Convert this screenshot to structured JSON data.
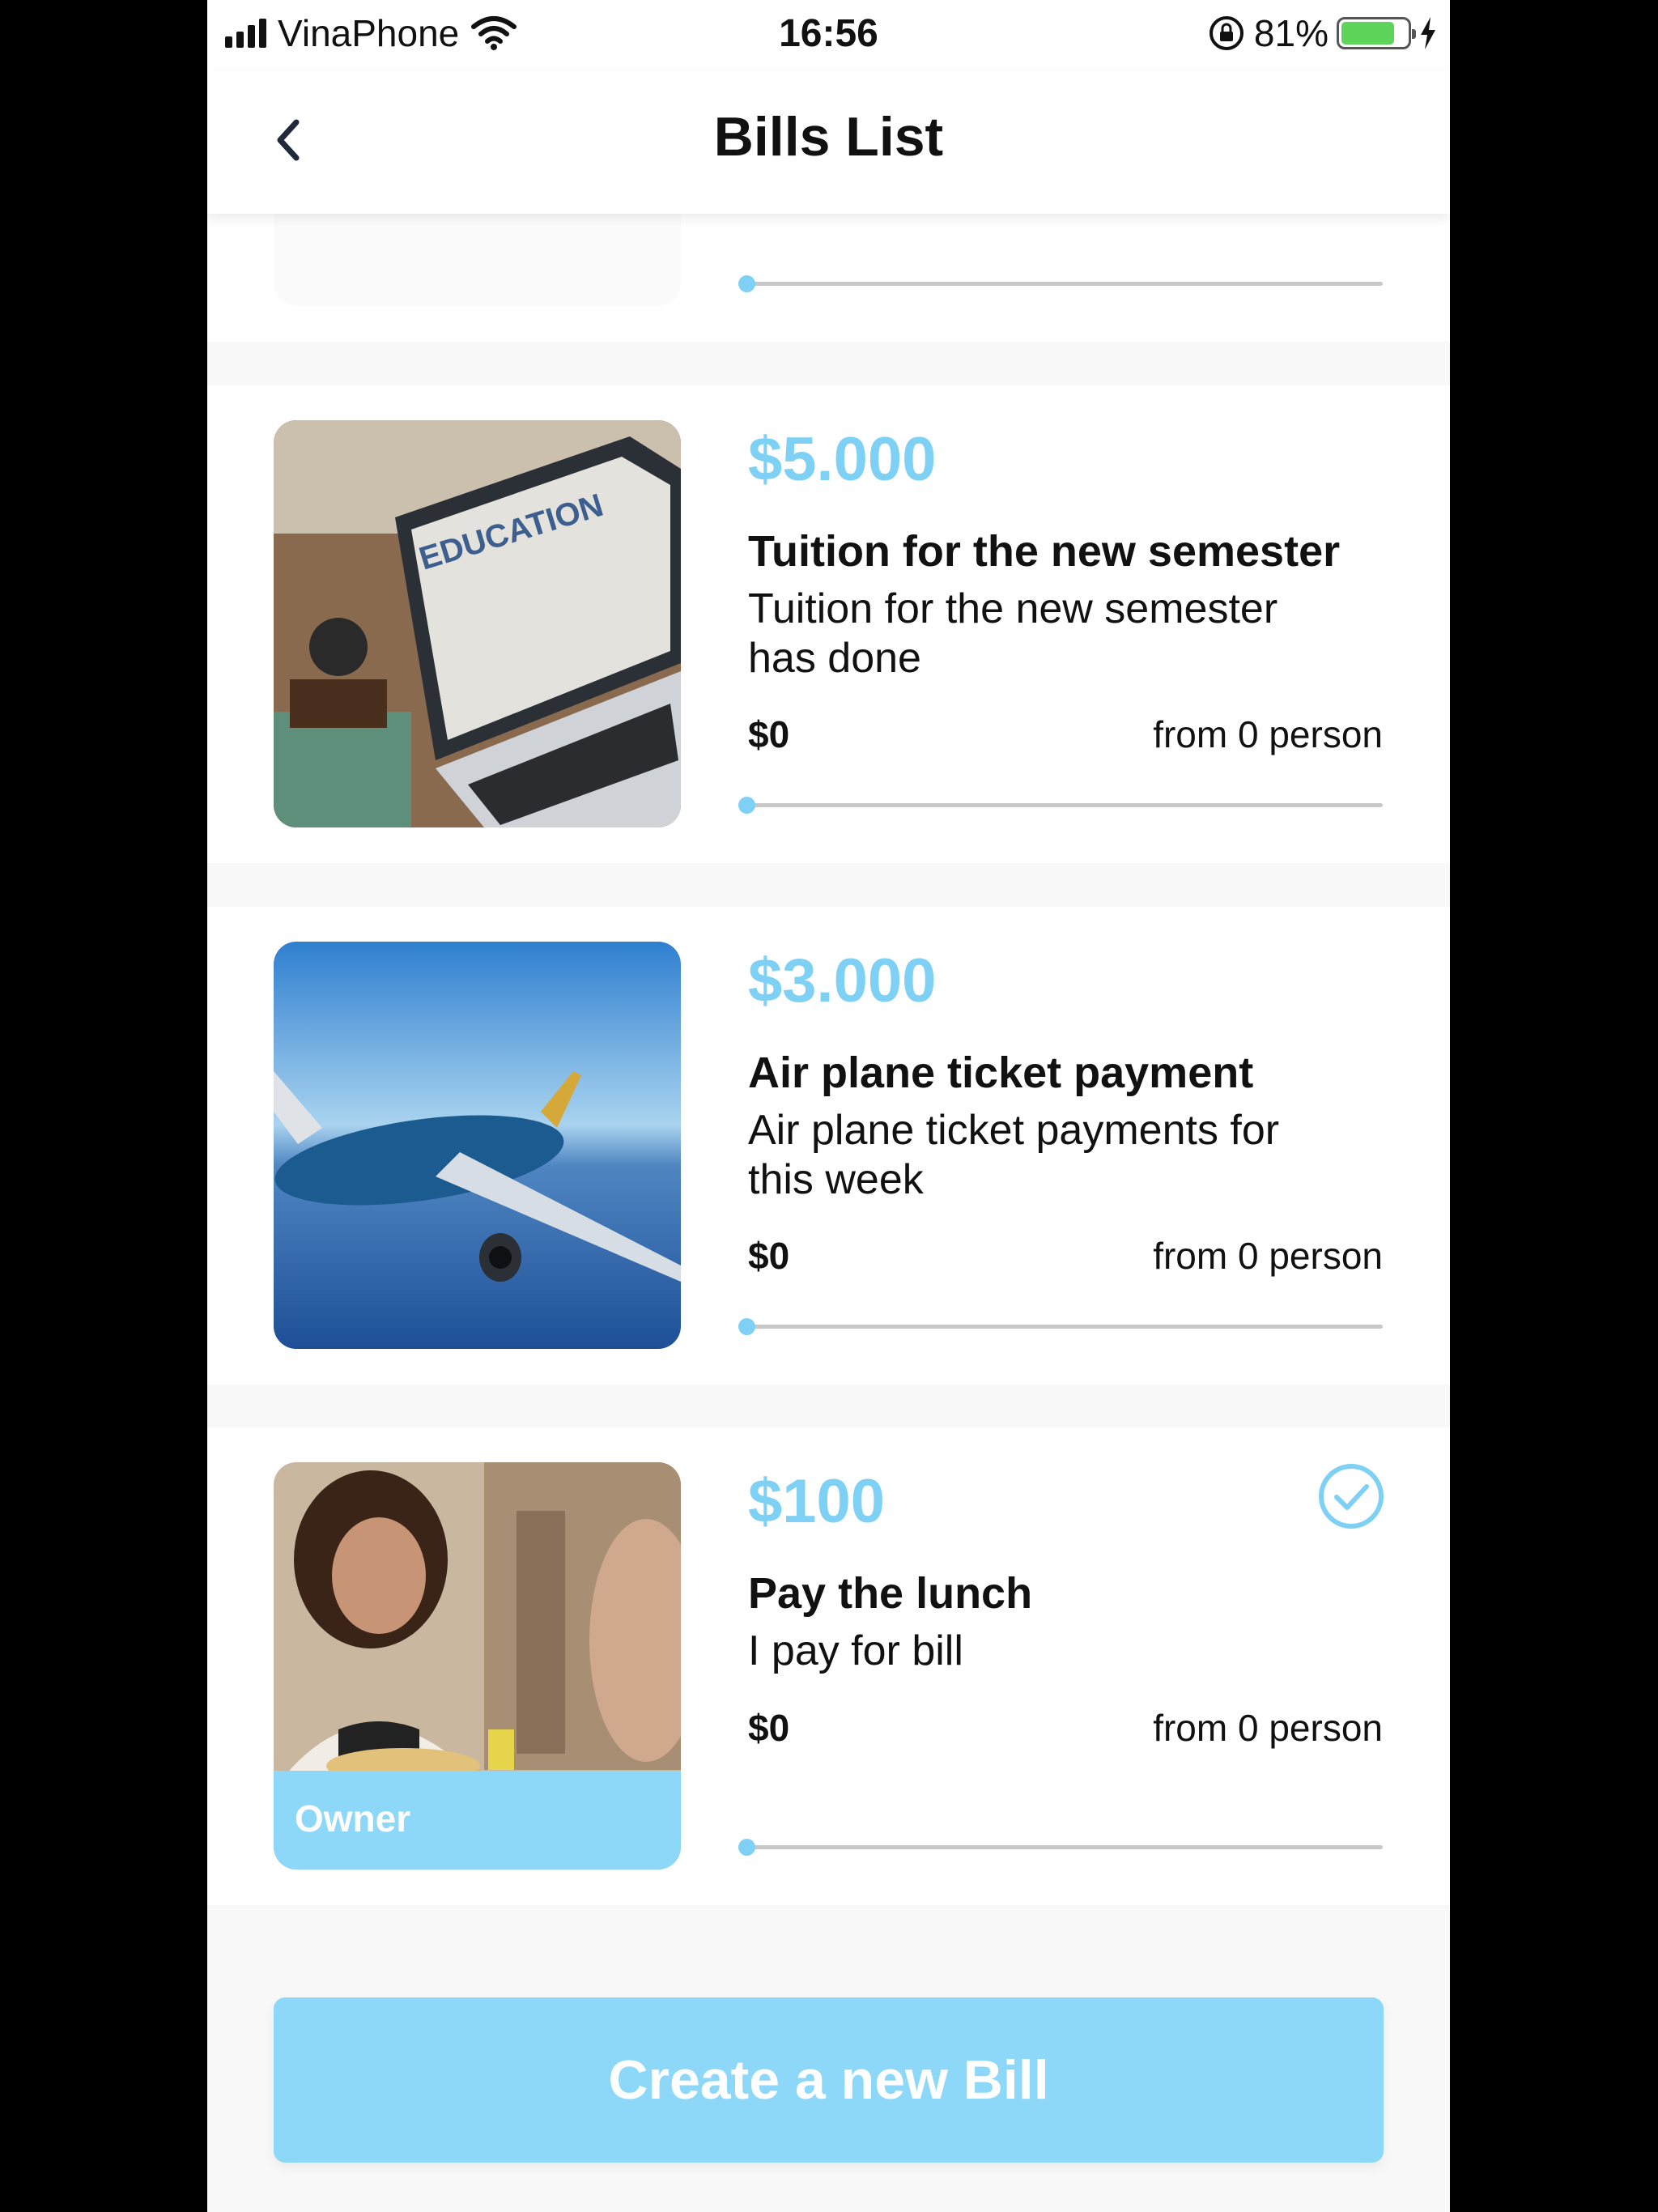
{
  "status_bar": {
    "carrier": "VinaPhone",
    "time": "16:56",
    "battery": "81%",
    "battery_level": 0.81,
    "icons": [
      "signal-icon",
      "wifi-icon",
      "orientation-lock-icon",
      "battery-icon",
      "charging-icon"
    ]
  },
  "header": {
    "title": "Bills List",
    "back_icon": "chevron-left-icon"
  },
  "bills": [
    {
      "amount": "$5.000",
      "title": "Tuition for the new semester",
      "description": "Tuition for the new semester has done",
      "paid": "$0",
      "from": "from 0 person",
      "progress": 0,
      "image": "education-laptop"
    },
    {
      "amount": "$3.000",
      "title": "Air plane ticket payment",
      "description": "Air plane ticket payments for this week",
      "paid": "$0",
      "from": "from 0 person",
      "progress": 0,
      "image": "airplane"
    },
    {
      "amount": "$100",
      "title": "Pay the lunch",
      "description": "I pay for bill",
      "paid": "$0",
      "from": "from 0 person",
      "progress": 0,
      "image": "woman-at-lunch",
      "badge": "Owner",
      "status_icon": "check-circle-icon"
    }
  ],
  "actions": {
    "create_label": "Create a new Bill"
  },
  "colors": {
    "accent": "#7fd0f5",
    "button": "#8dd8f8",
    "track": "#c8c8c8"
  }
}
